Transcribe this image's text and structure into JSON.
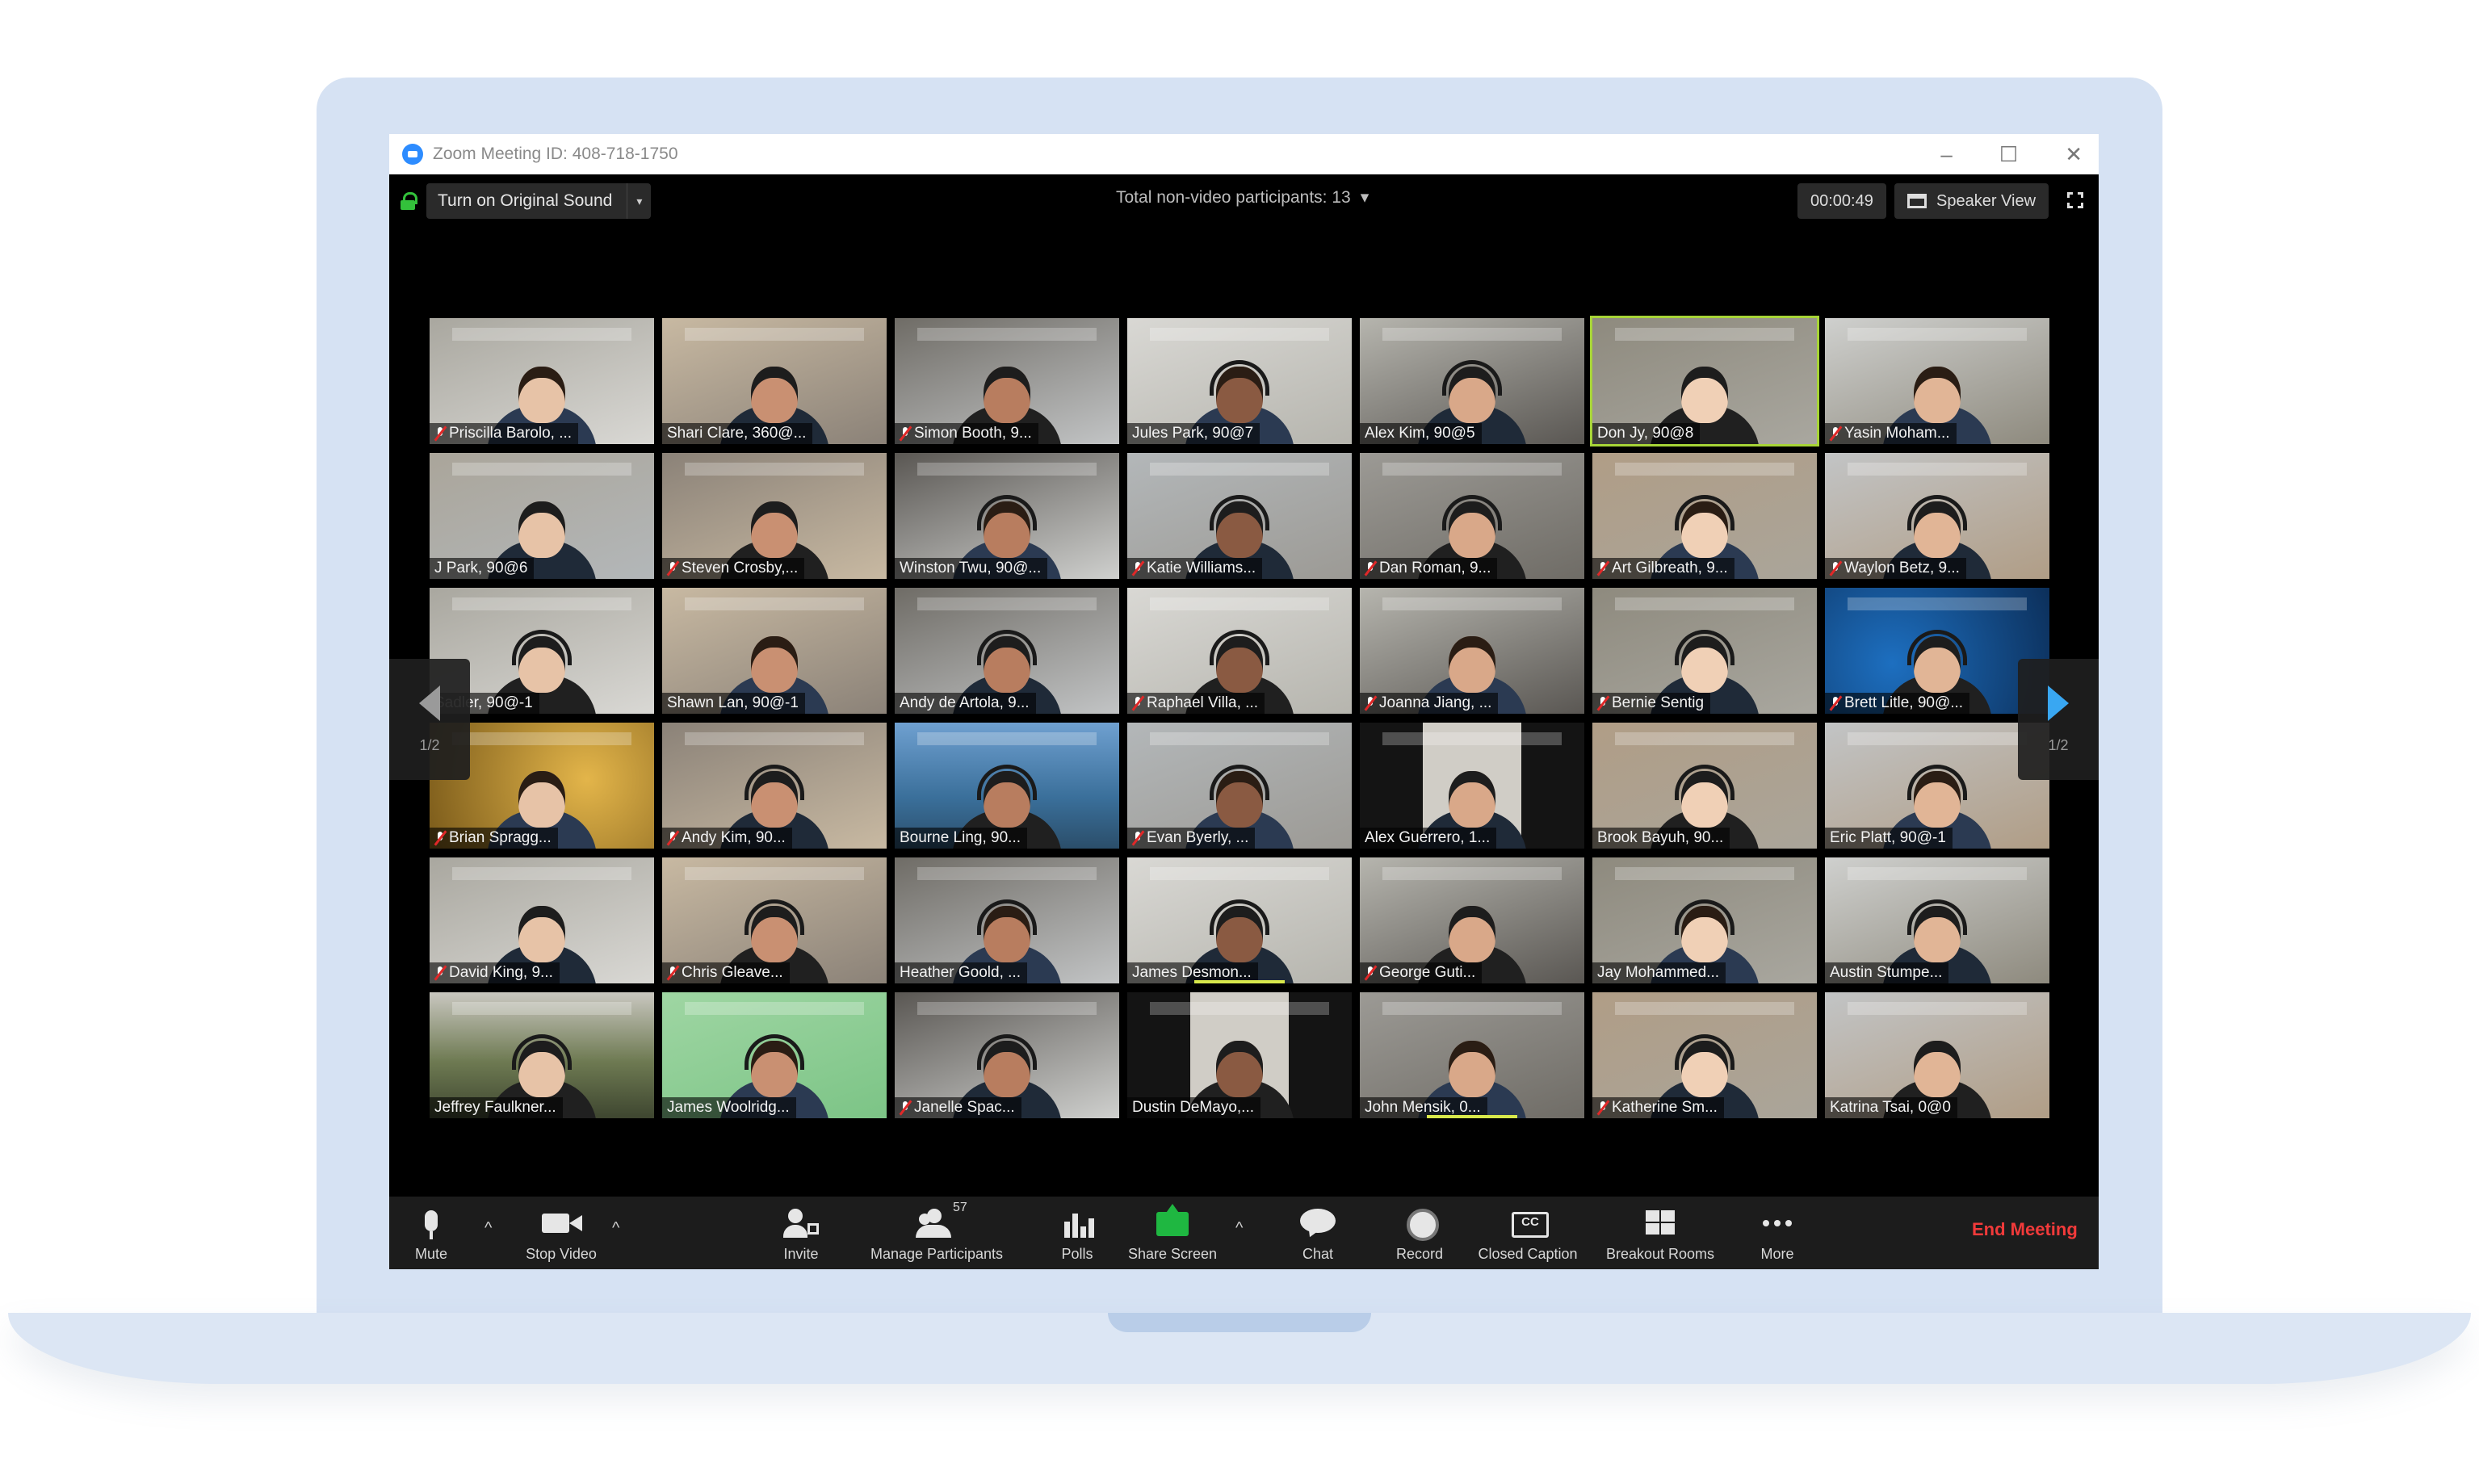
{
  "window": {
    "title": "Zoom Meeting ID: 408-718-1750",
    "controls": {
      "minimize": "–",
      "maximize": "☐",
      "close": "✕"
    }
  },
  "topbar": {
    "original_sound_label": "Turn on Original Sound",
    "original_sound_caret": "▾",
    "non_video_label": "Total non-video participants: 13",
    "non_video_caret": "▾",
    "timer": "00:00:49",
    "speaker_view_label": "Speaker View"
  },
  "pager": {
    "page_label_left": "1/2",
    "page_label_right": "1/2"
  },
  "participants": [
    {
      "name": "Priscilla Barolo, ...",
      "muted": true
    },
    {
      "name": "Shari Clare, 360@...",
      "muted": false
    },
    {
      "name": "Simon Booth, 9...",
      "muted": true
    },
    {
      "name": "Jules Park, 90@7",
      "muted": false
    },
    {
      "name": "Alex Kim, 90@5",
      "muted": false
    },
    {
      "name": "Don Jy, 90@8",
      "muted": false
    },
    {
      "name": "Yasin Moham...",
      "muted": true
    },
    {
      "name": "J Park, 90@6",
      "muted": false
    },
    {
      "name": "Steven Crosby,...",
      "muted": true
    },
    {
      "name": "Winston Twu, 90@...",
      "muted": false
    },
    {
      "name": "Katie Williams...",
      "muted": true
    },
    {
      "name": "Dan Roman, 9...",
      "muted": true
    },
    {
      "name": "Art Gilbreath, 9...",
      "muted": true
    },
    {
      "name": "Waylon Betz, 9...",
      "muted": true
    },
    {
      "name": "Sadler, 90@-1",
      "muted": false
    },
    {
      "name": "Shawn Lan, 90@-1",
      "muted": false
    },
    {
      "name": "Andy de Artola, 9...",
      "muted": false
    },
    {
      "name": "Raphael Villa, ...",
      "muted": true
    },
    {
      "name": "Joanna Jiang, ...",
      "muted": true
    },
    {
      "name": "Bernie Sentig",
      "muted": true
    },
    {
      "name": "Brett Litle, 90@...",
      "muted": true
    },
    {
      "name": "Brian Spragg...",
      "muted": true
    },
    {
      "name": "Andy Kim, 90...",
      "muted": true
    },
    {
      "name": "Bourne Ling, 90...",
      "muted": false
    },
    {
      "name": "Evan Byerly, ...",
      "muted": true
    },
    {
      "name": "Alex Guerrero, 1...",
      "muted": false
    },
    {
      "name": "Brook Bayuh, 90...",
      "muted": false
    },
    {
      "name": "Eric Platt, 90@-1",
      "muted": false
    },
    {
      "name": "David King, 9...",
      "muted": true
    },
    {
      "name": "Chris Gleave...",
      "muted": true
    },
    {
      "name": "Heather Goold, ...",
      "muted": false
    },
    {
      "name": "James Desmon...",
      "muted": false
    },
    {
      "name": "George Guti...",
      "muted": true
    },
    {
      "name": "Jay Mohammed...",
      "muted": false
    },
    {
      "name": "Austin Stumpe...",
      "muted": false
    },
    {
      "name": "Jeffrey Faulkner...",
      "muted": false
    },
    {
      "name": "James Woolridg...",
      "muted": false
    },
    {
      "name": "Janelle Spac...",
      "muted": true
    },
    {
      "name": "Dustin DeMayo,...",
      "muted": false
    },
    {
      "name": "John Mensik, 0...",
      "muted": false
    },
    {
      "name": "Katherine Sm...",
      "muted": true
    },
    {
      "name": "Katrina Tsai, 0@0",
      "muted": false
    }
  ],
  "toolbar": {
    "mute": "Mute",
    "stop_video": "Stop Video",
    "invite": "Invite",
    "manage_participants": "Manage Participants",
    "participant_count": "57",
    "polls": "Polls",
    "share_screen": "Share Screen",
    "chat": "Chat",
    "record": "Record",
    "closed_caption": "Closed Caption",
    "breakout_rooms": "Breakout Rooms",
    "more": "More",
    "end_meeting": "End Meeting",
    "caret": "^"
  },
  "colors": {
    "active_speaker_border": "#a7d437",
    "share_green": "#1fb741",
    "end_meeting_red": "#f23a3a",
    "laptop_frame": "#d6e2f3",
    "zoom_blue": "#2d8cff"
  }
}
